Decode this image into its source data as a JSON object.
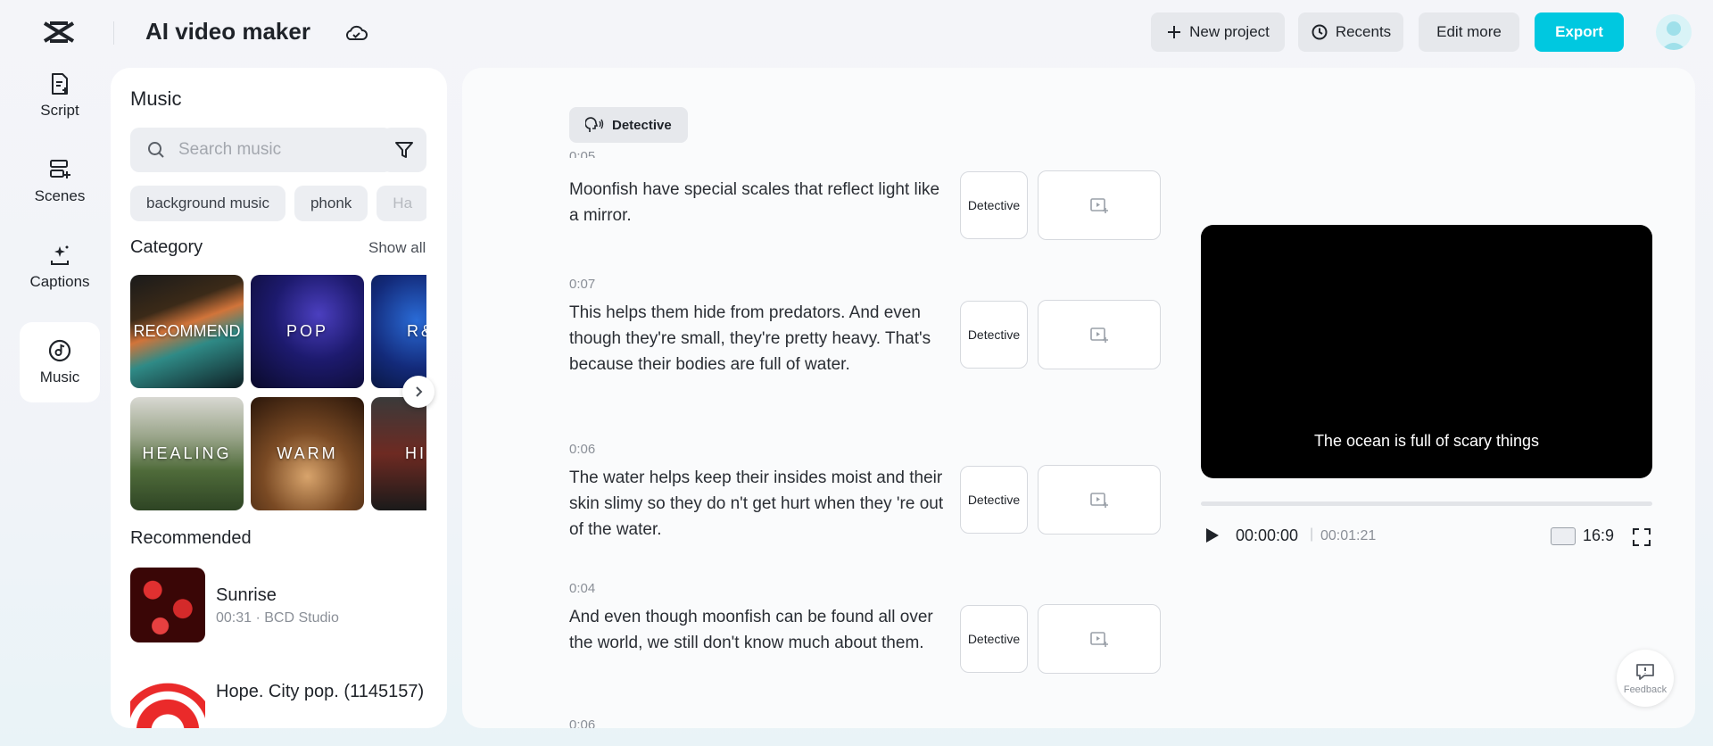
{
  "header": {
    "app_title": "AI video maker",
    "buttons": {
      "new_project": "New project",
      "recents": "Recents",
      "edit_more": "Edit more",
      "export": "Export"
    }
  },
  "nav": {
    "items": [
      {
        "label": "Script",
        "icon": "script-icon"
      },
      {
        "label": "Scenes",
        "icon": "scenes-icon"
      },
      {
        "label": "Captions",
        "icon": "captions-icon"
      },
      {
        "label": "Music",
        "icon": "music-icon",
        "active": true
      }
    ]
  },
  "music": {
    "title": "Music",
    "search_placeholder": "Search music",
    "chips": [
      "background music",
      "phonk",
      "Ha"
    ],
    "category_title": "Category",
    "show_all": "Show all",
    "categories": [
      "RECOMMEND",
      "POP",
      "R&",
      "HEALING",
      "WARM",
      "HI TEM"
    ],
    "recommended_title": "Recommended",
    "tracks": [
      {
        "name": "Sunrise",
        "meta": "00:31 · BCD Studio"
      },
      {
        "name": "Hope. City pop. (1145157)",
        "meta": ""
      }
    ]
  },
  "script": {
    "voice_tag": "Detective",
    "top_partial_time": "0:05",
    "rows": [
      {
        "time": "",
        "text": "Moonfish have special scales that reflect light like a mirror.",
        "voice": "Detective"
      },
      {
        "time": "0:07",
        "text": "This helps them hide from predators. And even though they're small, they're pretty heavy. That's because their bodies are full of water.",
        "voice": "Detective"
      },
      {
        "time": "0:06",
        "text": "The water helps keep their insides moist and their skin slimy so they do n't get hurt when they 're out of the water.",
        "voice": "Detective"
      },
      {
        "time": "0:04",
        "text": "And even though moonfish can be found all over the world, we still don't know much about them.",
        "voice": "Detective"
      }
    ],
    "bottom_partial_time": "0:06"
  },
  "player": {
    "caption": "The ocean is full of scary things",
    "current_time": "00:00:00",
    "separator": "|",
    "total_time": "00:01:21",
    "aspect_ratio": "16:9",
    "progress": 0
  },
  "feedback": {
    "label": "Feedback"
  },
  "colors": {
    "accent": "#00c8e0",
    "video_bg": "#000000"
  }
}
